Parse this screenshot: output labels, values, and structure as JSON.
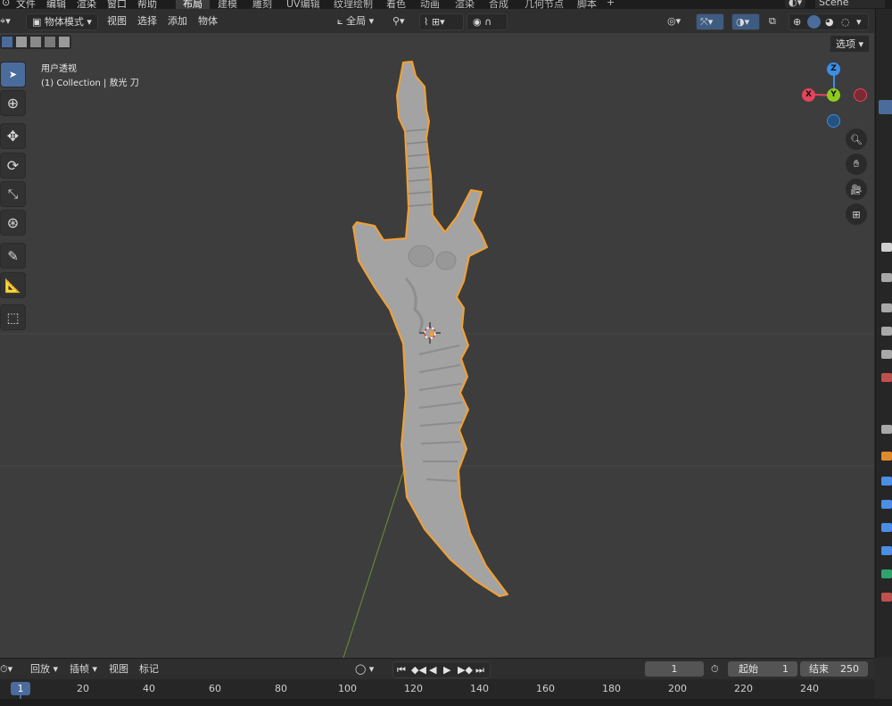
{
  "menu": {
    "items": [
      "文件",
      "编辑",
      "渲染",
      "窗口",
      "帮助"
    ],
    "workspaces": [
      "布局",
      "建模",
      "雕刻",
      "UV编辑",
      "纹理绘制",
      "着色",
      "动画",
      "渲染",
      "合成",
      "几何节点",
      "脚本"
    ],
    "add_tab": "+",
    "scene_name": "Scene"
  },
  "header": {
    "mode_label": "物体模式",
    "view": "视图",
    "select": "选择",
    "add": "添加",
    "object": "物体",
    "transform_orientation": "全局",
    "options": "选项"
  },
  "overlay": {
    "view_name": "用户透视",
    "collection_line": "(1) Collection | 敖光 刀"
  },
  "gizmo": {
    "x": "X",
    "y": "Y",
    "z": "Z"
  },
  "timeline": {
    "playback": "回放",
    "keying": "插帧",
    "view": "视图",
    "marker": "标记",
    "current_frame": "1",
    "start_label": "起始",
    "start_value": "1",
    "end_label": "结束",
    "end_value": "250",
    "playhead": "1",
    "ticks": [
      "20",
      "40",
      "60",
      "80",
      "100",
      "120",
      "140",
      "160",
      "180",
      "200",
      "220",
      "240"
    ]
  },
  "colors": {
    "accent": "#4a6c9c",
    "selection_outline": "#f5a030",
    "x_axis": "#e4445a",
    "y_axis": "#8ccc1e",
    "z_axis": "#3a8ee6"
  }
}
